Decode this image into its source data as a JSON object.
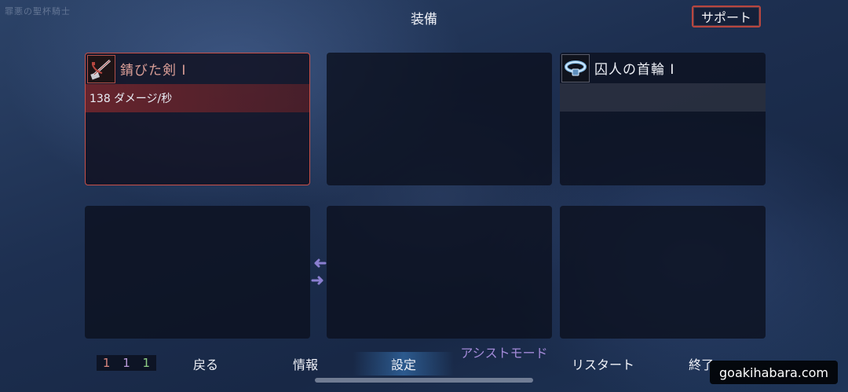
{
  "app": {
    "logo_text": "罪悪の聖杯騎士",
    "title": "装備"
  },
  "support_button": {
    "label": "サポート"
  },
  "slots": [
    {
      "name": "錆びた剣 Ⅰ",
      "stat": "138 ダメージ/秒",
      "icon": "rusty-sword-icon",
      "selected": true
    },
    {
      "name": "",
      "stat": "",
      "icon": ""
    },
    {
      "name": "囚人の首輪 Ⅰ",
      "stat": "",
      "icon": "prisoner-collar-icon"
    },
    {
      "name": "",
      "stat": "",
      "icon": ""
    },
    {
      "name": "",
      "stat": "",
      "icon": ""
    },
    {
      "name": "",
      "stat": "",
      "icon": ""
    }
  ],
  "bottom_bar": {
    "counters": [
      "1",
      "1",
      "1"
    ],
    "back": "戻る",
    "info": "情報",
    "settings": "設定",
    "assist_mode": "アシストモード",
    "restart": "リスタート",
    "quit": "終了"
  },
  "watermark": "goakihabara.com",
  "colors": {
    "selected_border": "#c75049",
    "assist_text": "#a38ad8",
    "weapon_stat_bg": "#82282d"
  }
}
